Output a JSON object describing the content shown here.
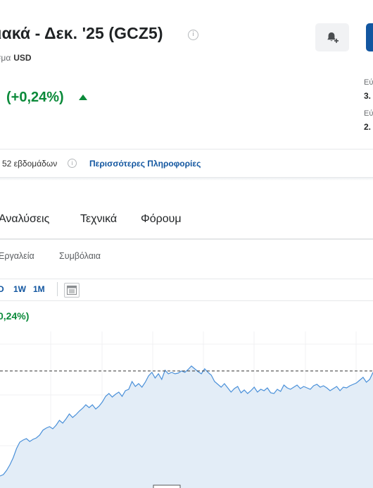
{
  "header": {
    "title": "ιακά - Δεκ. '25 (GCZ5)",
    "info_glyph": "i",
    "currency_label": "σμα",
    "currency_value": "USD",
    "change_text": "(+0,24%)"
  },
  "side_panel": {
    "row1_label": "Εύ",
    "row1_value": "3.",
    "row2_label": "Εύ",
    "row2_value": "2."
  },
  "range": {
    "label": "52 εβδομάδων",
    "info_glyph": "i",
    "more_link": "Περισσότερες Πληροφορίες"
  },
  "tabs": [
    "Αναλύσεις",
    "Τεχνικά",
    "Φόρουμ"
  ],
  "subtabs": [
    "Εργαλεία",
    "Συμβόλαια"
  ],
  "periods": [
    "D",
    "1W",
    "1M"
  ],
  "chart_change": "0,24%)",
  "colors": {
    "green": "#0b8a3a",
    "link_blue": "#1256a0",
    "line_blue": "#4a90d9",
    "area_fill": "#e3edf7"
  },
  "icons": {
    "bell_plus": "bell-plus-icon",
    "layout": "layout-icon",
    "caret_up": "caret-up-icon"
  },
  "chart_data": {
    "type": "area",
    "x": [],
    "values": [
      205,
      203,
      197,
      189,
      179,
      166,
      157,
      154,
      152,
      156,
      153,
      151,
      147,
      140,
      137,
      135,
      138,
      133,
      126,
      130,
      124,
      117,
      122,
      118,
      113,
      109,
      104,
      108,
      104,
      110,
      106,
      100,
      92,
      88,
      93,
      89,
      86,
      92,
      84,
      82,
      71,
      78,
      74,
      79,
      72,
      63,
      58,
      66,
      60,
      68,
      55,
      60,
      58,
      60,
      59,
      56,
      58,
      54,
      49,
      53,
      57,
      60,
      53,
      58,
      62,
      71,
      75,
      79,
      74,
      80,
      86,
      81,
      78,
      87,
      83,
      88,
      84,
      79,
      86,
      82,
      84,
      80,
      87,
      88,
      82,
      85,
      76,
      80,
      82,
      79,
      76,
      81,
      78,
      80,
      82,
      77,
      75,
      79,
      77,
      80,
      84,
      81,
      78,
      84,
      79,
      80,
      77,
      75,
      73,
      69,
      65,
      72,
      68,
      58
    ],
    "reference_line": 56,
    "ylim": [
      0,
      222
    ]
  }
}
